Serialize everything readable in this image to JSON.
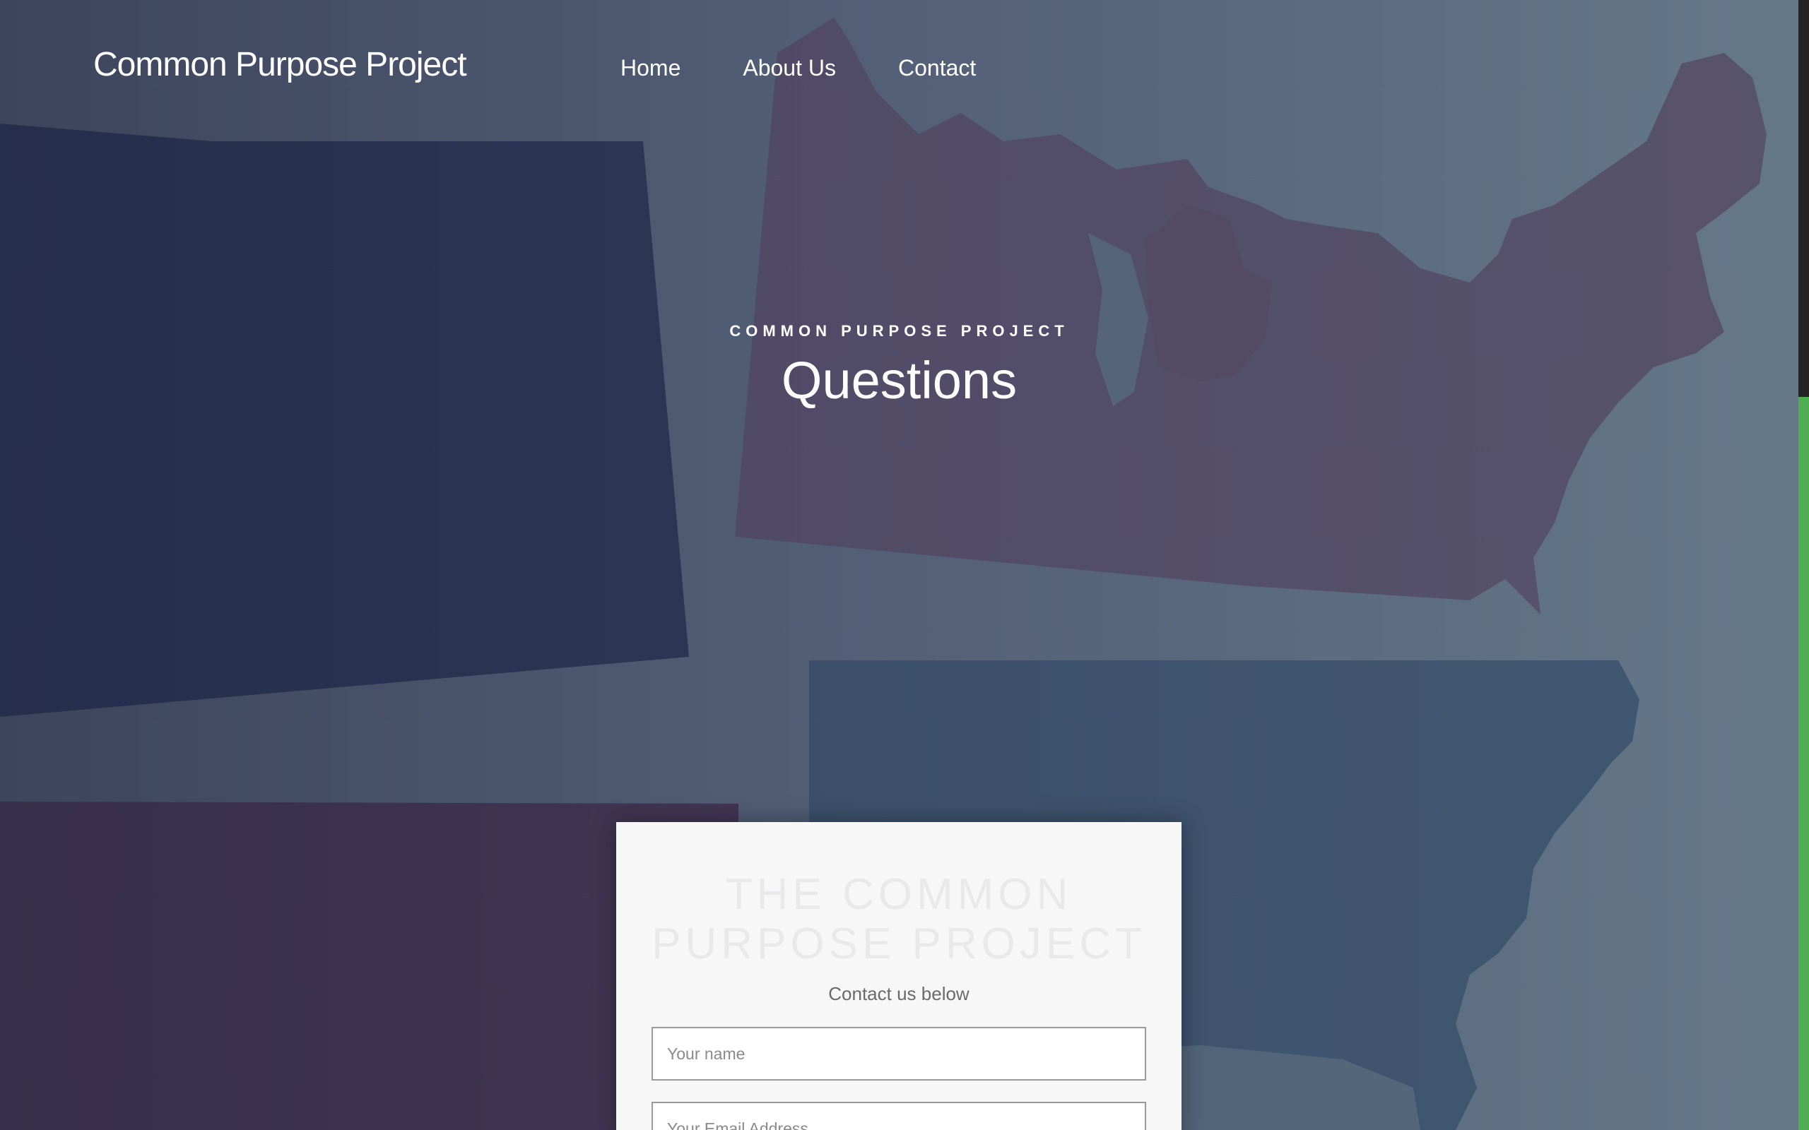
{
  "header": {
    "site_title": "Common Purpose Project",
    "nav": [
      "Home",
      "About Us",
      "Contact"
    ]
  },
  "hero": {
    "eyebrow": "COMMON PURPOSE PROJECT",
    "title": "Questions"
  },
  "contact_card": {
    "heading": "THE COMMON\nPURPOSE PROJECT",
    "subheading": "Contact us below",
    "name_placeholder": "Your name",
    "email_placeholder": "Your Email Address"
  },
  "colors": {
    "scrollbar_track": "#4fae50",
    "scrollbar_thumb": "#242424",
    "card_background": "#f7f7f7"
  }
}
